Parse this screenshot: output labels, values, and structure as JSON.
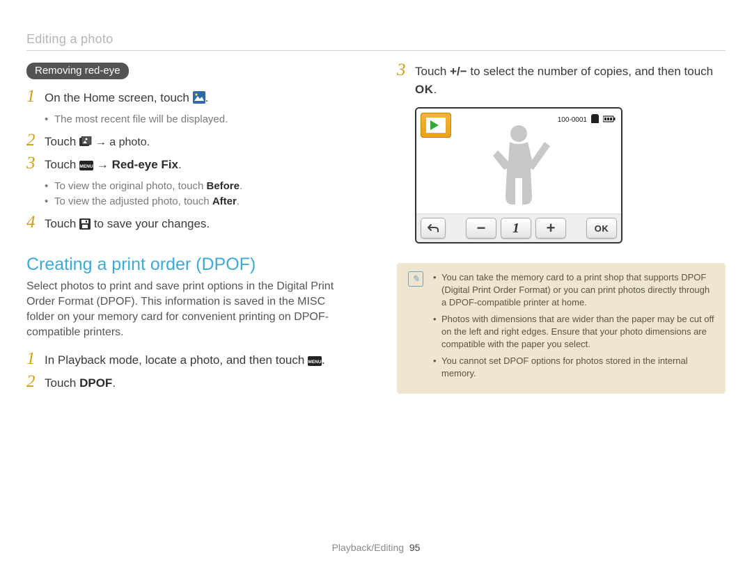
{
  "header": {
    "breadcrumb": "Editing a photo"
  },
  "removing": {
    "pill": "Removing red-eye",
    "step1": "On the Home screen, touch ",
    "step1_sub1": "The most recent file will be displayed.",
    "step2_a": "Touch ",
    "step2_b": " → a photo.",
    "step3_a": "Touch ",
    "step3_b": " → ",
    "step3_bold": "Red-eye Fix",
    "step3_c": ".",
    "step3_sub1_a": "To view the original photo, touch ",
    "step3_sub1_bold": "Before",
    "step3_sub1_b": ".",
    "step3_sub2_a": "To view the adjusted photo, touch ",
    "step3_sub2_bold": "After",
    "step3_sub2_b": ".",
    "step4_a": "Touch ",
    "step4_b": " to save your changes."
  },
  "dpof": {
    "title": "Creating a print order (DPOF)",
    "intro": "Select photos to print and save print options in the Digital Print Order Format (DPOF). This information is saved in the MISC folder on your memory card for convenient printing on DPOF-compatible printers.",
    "step1_a": "In Playback mode, locate a photo, and then touch ",
    "step1_b": ".",
    "step2_a": "Touch ",
    "step2_bold": "DPOF",
    "step2_b": "."
  },
  "right": {
    "step3_a": "Touch ",
    "step3_pm": "+/−",
    "step3_b": " to select the number of copies, and then touch ",
    "step3_ok": "OK",
    "step3_c": "."
  },
  "camera": {
    "file_counter": "100-0001",
    "count": "1",
    "minus": "−",
    "plus": "+",
    "ok": "OK"
  },
  "info": {
    "note1": "You can take the memory card to a print shop that supports DPOF (Digital Print Order Format) or you can print photos directly through a DPOF-compatible printer at home.",
    "note2": "Photos with dimensions that are wider than the paper may be cut off on the left and right edges. Ensure that your photo dimensions are compatible with the paper you select.",
    "note3": "You cannot set DPOF options for photos stored in the internal memory."
  },
  "footer": {
    "section": "Playback/Editing",
    "page": "95"
  }
}
